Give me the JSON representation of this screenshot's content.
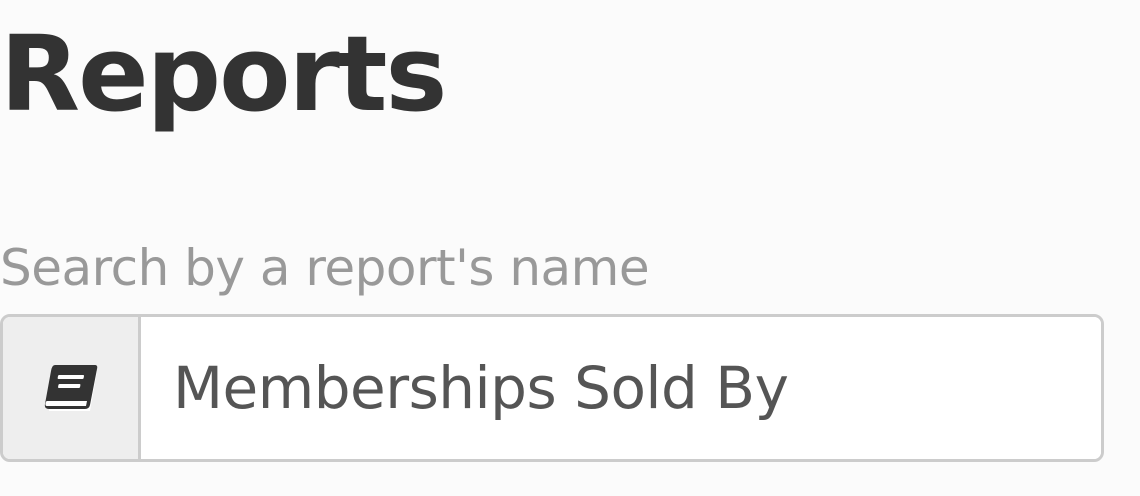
{
  "page": {
    "title": "Reports"
  },
  "search": {
    "label": "Search by a report's name",
    "value": "Memberships Sold By",
    "placeholder": "",
    "icon": "book-icon"
  },
  "colors": {
    "background": "#fbfbfb",
    "title": "#333333",
    "label": "#999999",
    "input_border": "#cccccc",
    "addon_background": "#eeeeee",
    "input_text": "#555555"
  }
}
